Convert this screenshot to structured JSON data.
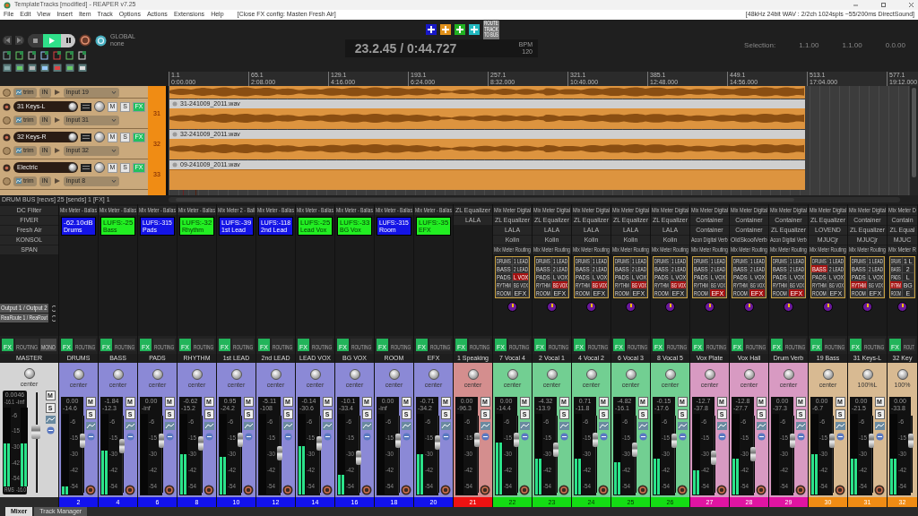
{
  "window": {
    "title": "TemplateTracks [modified] - REAPER v7.25"
  },
  "menu": [
    "File",
    "Edit",
    "View",
    "Insert",
    "Item",
    "Track",
    "Options",
    "Actions",
    "Extensions",
    "Help"
  ],
  "menu_status": "[Close FX config: Masten Fresh Air]",
  "audio_status": "[48kHz 24bit WAV : 2/2ch 1024spls ~55/200ms DirectSound]",
  "transport": {
    "playing": true,
    "automation_label": "GLOBAL",
    "automation_mode": "none"
  },
  "add_buttons": [
    {
      "color": "#1818c8"
    },
    {
      "color": "#e0901a"
    },
    {
      "color": "#22b022"
    },
    {
      "color": "#22b8c0"
    }
  ],
  "route_button": [
    "ROUTE",
    "TRACK",
    "TO BUS"
  ],
  "time": "23.2.45 / 0:44.727",
  "bpm_label": "BPM",
  "bpm": "120",
  "selection": {
    "label": "Selection:",
    "start": "1.1.00",
    "end": "1.1.00",
    "length": "0.0.00"
  },
  "ruler": [
    {
      "bar": "1.1",
      "time": "0:00.000"
    },
    {
      "bar": "65.1",
      "time": "2:08.000"
    },
    {
      "bar": "129.1",
      "time": "4:16.000"
    },
    {
      "bar": "193.1",
      "time": "6:24.000"
    },
    {
      "bar": "257.1",
      "time": "8:32.000"
    },
    {
      "bar": "321.1",
      "time": "10:40.000"
    },
    {
      "bar": "385.1",
      "time": "12:48.000"
    },
    {
      "bar": "449.1",
      "time": "14:56.000"
    },
    {
      "bar": "513.1",
      "time": "17:04.000"
    },
    {
      "bar": "577.1",
      "time": "19:12.000"
    }
  ],
  "partial_track": {
    "automation": "trim",
    "monitor": "IN",
    "input": "Input 19"
  },
  "tracks": [
    {
      "name": "31 Keys-L",
      "number": "31",
      "automation": "trim",
      "monitor": "IN",
      "input": "Input 31",
      "mute": "M",
      "solo": "S",
      "fx": "FX",
      "item": "31-241009_2011.wav",
      "waveform": true
    },
    {
      "name": "32 Keys-R",
      "number": "32",
      "automation": "trim",
      "monitor": "IN",
      "input": "Input 32",
      "mute": "M",
      "solo": "S",
      "fx": "FX",
      "item": "32-241009_2011.wav",
      "waveform": true
    },
    {
      "name": "Electric",
      "number": "33",
      "automation": "trim",
      "monitor": "IN",
      "input": "Input 8",
      "mute": "M",
      "solo": "S",
      "fx": "FX",
      "item": "09-241009_2011.wav",
      "waveform": false
    }
  ],
  "status": "DRUM BUS [recvs] 25 [sends] 1 [FX] 1",
  "master": {
    "name": "MASTER",
    "fx": [
      "DC Filter",
      "FIVER",
      "Fresh Air",
      "KONSOL",
      "SPAN"
    ],
    "sends": [
      "Output 1 / Output 2",
      "ReaRoute 1 / ReaRout"
    ],
    "fx_btn": "FX",
    "routing_btn": "ROUTING",
    "mono_btn": "MONO",
    "pan": "center",
    "volume": "0.0046",
    "peak_l": "-16.1",
    "peak_r": "-inf",
    "scale": [
      "-6",
      "-15",
      "-30",
      "-42",
      "-54"
    ],
    "mute": "M",
    "solo": "S",
    "rms_label": "RMS",
    "rms": "-16.0",
    "meter": {
      "level": 0.55
    },
    "fader": {
      "level": 0.62
    }
  },
  "strips": [
    {
      "name": "DRUMS",
      "number": "2",
      "kind": "bus",
      "fx": [
        "Mix Meter - Ballas"
      ],
      "display": {
        "value": "-62.10dB",
        "label": "Drums",
        "color": "#1414e6"
      },
      "fx_btn": "FX",
      "routing_btn": "ROUTING",
      "pan": "center",
      "volume": "0.00",
      "peak": "-14.6",
      "scale": [
        "-6",
        "-15",
        "-30",
        "-42",
        "-54"
      ],
      "mute": "M",
      "solo": "S",
      "meter": {
        "level": 0.1
      },
      "fader": {
        "level": 0.7
      }
    },
    {
      "name": "BASS",
      "number": "4",
      "kind": "bus",
      "fx": [
        "Mix Meter - Ballas"
      ],
      "display": {
        "value": "LUFS:-25",
        "label": "Bass",
        "color": "#22ee22"
      },
      "fx_btn": "FX",
      "routing_btn": "ROUTING",
      "pan": "center",
      "volume": "-1.84",
      "peak": "-12.3",
      "scale": [
        "-6",
        "-15",
        "-30",
        "-42",
        "-54"
      ],
      "mute": "M",
      "solo": "S",
      "meter": {
        "level": 0.55
      },
      "fader": {
        "level": 0.62
      }
    },
    {
      "name": "PADS",
      "number": "6",
      "kind": "bus",
      "fx": [
        "Mix Meter - Ballas"
      ],
      "display": {
        "value": "LUFS:-315",
        "label": "Pads",
        "color": "#1414e6"
      },
      "fx_btn": "FX",
      "routing_btn": "ROUTING",
      "pan": "center",
      "volume": "0.00",
      "peak": "-inf",
      "scale": [
        "-6",
        "-15",
        "-30",
        "-42",
        "-54"
      ],
      "mute": "M",
      "solo": "S",
      "meter": {
        "level": 0
      },
      "fader": {
        "level": 0.7
      }
    },
    {
      "name": "RHYTHM",
      "number": "8",
      "kind": "bus",
      "fx": [
        "Mix Meter - Ballas"
      ],
      "display": {
        "value": "LUFS:-32",
        "label": "Rhythm",
        "color": "#22ee22"
      },
      "fx_btn": "FX",
      "routing_btn": "ROUTING",
      "pan": "center",
      "volume": "-0.62",
      "peak": "-15.2",
      "scale": [
        "-6",
        "-15",
        "-30",
        "-42",
        "-54"
      ],
      "mute": "M",
      "solo": "S",
      "meter": {
        "level": 0.5
      },
      "fader": {
        "level": 0.66
      }
    },
    {
      "name": "1st LEAD",
      "number": "10",
      "kind": "bus",
      "fx": [
        "Mix Meter 2 - Ball"
      ],
      "display": {
        "value": "LUFS:-39",
        "label": "1st Lead",
        "color": "#1414e6"
      },
      "fx_btn": "FX",
      "routing_btn": "ROUTING",
      "pan": "center",
      "volume": "0.95",
      "peak": "-24.2",
      "scale": [
        "-6",
        "-15",
        "-30",
        "-42",
        "-54"
      ],
      "mute": "M",
      "solo": "S",
      "meter": {
        "level": 0.47
      },
      "fader": {
        "level": 0.72
      }
    },
    {
      "name": "2nd LEAD",
      "number": "12",
      "kind": "bus",
      "fx": [
        "Mix Meter - Ballas"
      ],
      "display": {
        "value": "LUFS:-118",
        "label": "2nd Lead",
        "color": "#1414e6"
      },
      "fx_btn": "FX",
      "routing_btn": "ROUTING",
      "pan": "center",
      "volume": "-5.11",
      "peak": "-108",
      "scale": [
        "-6",
        "-15",
        "-30",
        "-42",
        "-54"
      ],
      "mute": "M",
      "solo": "S",
      "meter": {
        "level": 0
      },
      "fader": {
        "level": 0.52
      }
    },
    {
      "name": "LEAD VOX",
      "number": "14",
      "kind": "bus",
      "fx": [
        "Mix Meter - Ballas"
      ],
      "display": {
        "value": "LUFS:-25",
        "label": "Lead Vox",
        "color": "#22ee22"
      },
      "fx_btn": "FX",
      "routing_btn": "ROUTING",
      "pan": "center",
      "volume": "-0.14",
      "peak": "-30.6",
      "scale": [
        "-6",
        "-15",
        "-30",
        "-42",
        "-54"
      ],
      "mute": "M",
      "solo": "S",
      "meter": {
        "level": 0.6
      },
      "fader": {
        "level": 0.66
      }
    },
    {
      "name": "BG VOX",
      "number": "16",
      "kind": "bus",
      "fx": [
        "Mix Meter - Ballas"
      ],
      "display": {
        "value": "LUFS:-33",
        "label": "BG Vox",
        "color": "#22ee22"
      },
      "fx_btn": "FX",
      "routing_btn": "ROUTING",
      "pan": "center",
      "volume": "-10.1",
      "peak": "-33.4",
      "scale": [
        "-6",
        "-15",
        "-30",
        "-42",
        "-54"
      ],
      "mute": "M",
      "solo": "S",
      "meter": {
        "level": 0.25
      },
      "fader": {
        "level": 0.45
      }
    },
    {
      "name": "ROOM",
      "number": "18",
      "kind": "bus",
      "fx": [
        "Mix Meter - Ballas"
      ],
      "display": {
        "value": "LUFS:-315",
        "label": "Room",
        "color": "#1414e6"
      },
      "fx_btn": "FX",
      "routing_btn": "ROUTING",
      "pan": "center",
      "volume": "0.00",
      "peak": "-inf",
      "scale": [
        "-6",
        "-15",
        "-30",
        "-42",
        "-54"
      ],
      "mute": "M",
      "solo": "S",
      "meter": {
        "level": 0
      },
      "fader": {
        "level": 0.7
      }
    },
    {
      "name": "EFX",
      "number": "20",
      "kind": "bus",
      "fx": [
        "Mix Meter - Ballas"
      ],
      "display": {
        "value": "LUFS:-35",
        "label": "EFX",
        "color": "#22ee22"
      },
      "fx_btn": "FX",
      "routing_btn": "ROUTING",
      "pan": "center",
      "volume": "-0.71",
      "peak": "-34.2",
      "scale": [
        "-6",
        "-15",
        "-30",
        "-42",
        "-54"
      ],
      "mute": "M",
      "solo": "S",
      "meter": {
        "level": 0.5
      },
      "fader": {
        "level": 0.68
      }
    },
    {
      "name": "1 Speaking",
      "number": "21",
      "kind": "speaking",
      "fx": [
        "ZL Equalizer",
        "LALA"
      ],
      "fx_btn": "FX",
      "routing_btn": "ROUTING",
      "pan": "center",
      "volume": "0.00",
      "peak": "-96.3",
      "scale": [
        "-6",
        "-15",
        "-30",
        "-42",
        "-54"
      ],
      "mute": "M",
      "solo": "S",
      "meter": {
        "level": 0
      },
      "fader": {
        "level": 0.72
      }
    },
    {
      "name": "7 Vocal 4",
      "number": "22",
      "kind": "vocal",
      "fx": [
        "Mix Meter Digital",
        "ZL Equalizer",
        "LALA",
        "Kolin",
        "Mix Meter Routing"
      ],
      "routing": [
        {
          "label": "DRUMS",
          "selected": false
        },
        {
          "label": "1 LEAD",
          "selected": false
        },
        {
          "label": "BASS",
          "selected": false
        },
        {
          "label": "2 LEAD",
          "selected": false
        },
        {
          "label": "PADS",
          "selected": false
        },
        {
          "label": "L VOX",
          "selected": true
        },
        {
          "label": "RYTHM",
          "selected": false
        },
        {
          "label": "BG VOX",
          "selected": false
        },
        {
          "label": "ROOM",
          "selected": false
        },
        {
          "label": "EFX",
          "selected": false
        }
      ],
      "fx_btn": "FX",
      "routing_btn": "ROUTING",
      "pan": "center",
      "volume": "0.00",
      "peak": "-14.4",
      "scale": [
        "-6",
        "-15",
        "-30",
        "-42",
        "-54"
      ],
      "mute": "M",
      "solo": "S",
      "meter": {
        "level": 0.65
      },
      "fader": {
        "level": 0.72
      }
    },
    {
      "name": "2 Vocal 1",
      "number": "23",
      "kind": "vocal",
      "fx": [
        "Mix Meter Digital",
        "ZL Equalizer",
        "LALA",
        "Kolin",
        "Mix Meter Routing"
      ],
      "routing": [
        {
          "label": "DRUMS",
          "selected": false
        },
        {
          "label": "1 LEAD",
          "selected": false
        },
        {
          "label": "BASS",
          "selected": false
        },
        {
          "label": "2 LEAD",
          "selected": false
        },
        {
          "label": "PADS",
          "selected": false
        },
        {
          "label": "L VOX",
          "selected": false
        },
        {
          "label": "RYTHM",
          "selected": false
        },
        {
          "label": "BG VOX",
          "selected": true
        },
        {
          "label": "ROOM",
          "selected": false
        },
        {
          "label": "EFX",
          "selected": false
        }
      ],
      "fx_btn": "FX",
      "routing_btn": "ROUTING",
      "pan": "center",
      "volume": "-4.32",
      "peak": "-13.9",
      "scale": [
        "-6",
        "-15",
        "-30",
        "-42",
        "-54"
      ],
      "mute": "M",
      "solo": "S",
      "meter": {
        "level": 0.45
      },
      "fader": {
        "level": 0.57
      }
    },
    {
      "name": "4 Vocal 2",
      "number": "24",
      "kind": "vocal",
      "fx": [
        "Mix Meter Digital",
        "ZL Equalizer",
        "LALA",
        "Kolin",
        "Mix Meter Routing"
      ],
      "routing": [
        {
          "label": "DRUMS",
          "selected": false
        },
        {
          "label": "1 LEAD",
          "selected": false
        },
        {
          "label": "BASS",
          "selected": false
        },
        {
          "label": "2 LEAD",
          "selected": false
        },
        {
          "label": "PADS",
          "selected": false
        },
        {
          "label": "L VOX",
          "selected": false
        },
        {
          "label": "RYTHM",
          "selected": false
        },
        {
          "label": "BG VOX",
          "selected": true
        },
        {
          "label": "ROOM",
          "selected": false
        },
        {
          "label": "EFX",
          "selected": false
        }
      ],
      "fx_btn": "FX",
      "routing_btn": "ROUTING",
      "pan": "center",
      "volume": "0.71",
      "peak": "-11.8",
      "scale": [
        "-6",
        "-15",
        "-30",
        "-42",
        "-54"
      ],
      "mute": "M",
      "solo": "S",
      "meter": {
        "level": 0.45
      },
      "fader": {
        "level": 0.72
      }
    },
    {
      "name": "6 Vocal 3",
      "number": "25",
      "kind": "vocal",
      "fx": [
        "Mix Meter Digital",
        "ZL Equalizer",
        "LALA",
        "Kolin",
        "Mix Meter Routing"
      ],
      "routing": [
        {
          "label": "DRUMS",
          "selected": false
        },
        {
          "label": "1 LEAD",
          "selected": false
        },
        {
          "label": "BASS",
          "selected": false
        },
        {
          "label": "2 LEAD",
          "selected": false
        },
        {
          "label": "PADS",
          "selected": false
        },
        {
          "label": "L VOX",
          "selected": false
        },
        {
          "label": "RYTHM",
          "selected": false
        },
        {
          "label": "BG VOX",
          "selected": true
        },
        {
          "label": "ROOM",
          "selected": false
        },
        {
          "label": "EFX",
          "selected": false
        }
      ],
      "fx_btn": "FX",
      "routing_btn": "ROUTING",
      "pan": "center",
      "volume": "-4.82",
      "peak": "-16.1",
      "scale": [
        "-6",
        "-15",
        "-30",
        "-42",
        "-54"
      ],
      "mute": "M",
      "solo": "S",
      "meter": {
        "level": 0.4
      },
      "fader": {
        "level": 0.57
      }
    },
    {
      "name": "8 Vocal 5",
      "number": "26",
      "kind": "vocal",
      "fx": [
        "Mix Meter Digital",
        "ZL Equalizer",
        "LALA",
        "Kolin",
        "Mix Meter Routing"
      ],
      "routing": [
        {
          "label": "DRUMS",
          "selected": false
        },
        {
          "label": "1 LEAD",
          "selected": false
        },
        {
          "label": "BASS",
          "selected": false
        },
        {
          "label": "2 LEAD",
          "selected": false
        },
        {
          "label": "PADS",
          "selected": false
        },
        {
          "label": "L VOX",
          "selected": false
        },
        {
          "label": "RYTHM",
          "selected": false
        },
        {
          "label": "BG VOX",
          "selected": true
        },
        {
          "label": "ROOM",
          "selected": false
        },
        {
          "label": "EFX",
          "selected": false
        }
      ],
      "fx_btn": "FX",
      "routing_btn": "ROUTING",
      "pan": "center",
      "volume": "-0.15",
      "peak": "-17.6",
      "scale": [
        "-6",
        "-15",
        "-30",
        "-42",
        "-54"
      ],
      "mute": "M",
      "solo": "S",
      "meter": {
        "level": 0.45
      },
      "fader": {
        "level": 0.7
      }
    },
    {
      "name": "Vox Plate",
      "number": "27",
      "kind": "verb",
      "fx": [
        "Mix Meter Digital",
        "Container",
        "Container",
        "Acon Digital Verb",
        "Mix Meter Routing"
      ],
      "routing": [
        {
          "label": "DRUMS",
          "selected": false
        },
        {
          "label": "1 LEAD",
          "selected": false
        },
        {
          "label": "BASS",
          "selected": false
        },
        {
          "label": "2 LEAD",
          "selected": false
        },
        {
          "label": "PADS",
          "selected": false
        },
        {
          "label": "L VOX",
          "selected": false
        },
        {
          "label": "RYTHM",
          "selected": false
        },
        {
          "label": "BG VOX",
          "selected": false
        },
        {
          "label": "ROOM",
          "selected": false
        },
        {
          "label": "EFX",
          "selected": true
        }
      ],
      "fx_btn": "FX",
      "routing_btn": "ROUTING",
      "pan": "center",
      "volume": "-12.7",
      "peak": "-37.8",
      "scale": [
        "-6",
        "-15",
        "-30",
        "-42",
        "-54"
      ],
      "mute": "M",
      "solo": "S",
      "meter": {
        "level": 0.3
      },
      "fader": {
        "level": 0.45
      }
    },
    {
      "name": "Vox Hall",
      "number": "28",
      "kind": "verb",
      "fx": [
        "Mix Meter Digital",
        "Container",
        "Container",
        "OldSkoolVerb",
        "Mix Meter Routing"
      ],
      "routing": [
        {
          "label": "DRUMS",
          "selected": false
        },
        {
          "label": "1 LEAD",
          "selected": false
        },
        {
          "label": "BASS",
          "selected": false
        },
        {
          "label": "2 LEAD",
          "selected": false
        },
        {
          "label": "PADS",
          "selected": false
        },
        {
          "label": "L VOX",
          "selected": false
        },
        {
          "label": "RYTHM",
          "selected": false
        },
        {
          "label": "BG VOX",
          "selected": false
        },
        {
          "label": "ROOM",
          "selected": false
        },
        {
          "label": "EFX",
          "selected": true
        }
      ],
      "fx_btn": "FX",
      "routing_btn": "ROUTING",
      "pan": "center",
      "volume": "-12.8",
      "peak": "-27.7",
      "scale": [
        "-6",
        "-15",
        "-30",
        "-42",
        "-54"
      ],
      "mute": "M",
      "solo": "S",
      "meter": {
        "level": 0.45
      },
      "fader": {
        "level": 0.5
      }
    },
    {
      "name": "Drum Verb",
      "number": "29",
      "kind": "verb",
      "fx": [
        "Mix Meter Digital",
        "Container",
        "ZL Equalizer",
        "Acon Digital Verb",
        "Mix Meter Routing"
      ],
      "routing": [
        {
          "label": "DRUMS",
          "selected": false
        },
        {
          "label": "1 LEAD",
          "selected": false
        },
        {
          "label": "BASS",
          "selected": false
        },
        {
          "label": "2 LEAD",
          "selected": false
        },
        {
          "label": "PADS",
          "selected": false
        },
        {
          "label": "L VOX",
          "selected": false
        },
        {
          "label": "RYTHM",
          "selected": false
        },
        {
          "label": "BG VOX",
          "selected": false
        },
        {
          "label": "ROOM",
          "selected": false
        },
        {
          "label": "EFX",
          "selected": true
        }
      ],
      "fx_btn": "FX",
      "routing_btn": "ROUTING",
      "pan": "center",
      "volume": "0.00",
      "peak": "-37.3",
      "scale": [
        "-6",
        "-15",
        "-30",
        "-42",
        "-54"
      ],
      "mute": "M",
      "solo": "S",
      "meter": {
        "level": 0
      },
      "fader": {
        "level": 0.7
      }
    },
    {
      "name": "19 Bass",
      "number": "30",
      "kind": "keys",
      "fx": [
        "Mix Meter Digital",
        "ZL Equalizer",
        "LOVEND",
        "MJUCjr",
        "Mix Meter Routing"
      ],
      "routing": [
        {
          "label": "DRUMS",
          "selected": false
        },
        {
          "label": "1 LEAD",
          "selected": false
        },
        {
          "label": "BASS",
          "selected": true
        },
        {
          "label": "2 LEAD",
          "selected": false
        },
        {
          "label": "PADS",
          "selected": false
        },
        {
          "label": "L VOX",
          "selected": false
        },
        {
          "label": "RYTHM",
          "selected": false
        },
        {
          "label": "BG VOX",
          "selected": false
        },
        {
          "label": "ROOM",
          "selected": false
        },
        {
          "label": "EFX",
          "selected": false
        }
      ],
      "fx_btn": "FX",
      "routing_btn": "ROUTING",
      "pan": "center",
      "volume": "0.00",
      "peak": "-6.7",
      "scale": [
        "-6",
        "-15",
        "-30",
        "-42",
        "-54"
      ],
      "mute": "M",
      "solo": "S",
      "meter": {
        "level": 0.5
      },
      "fader": {
        "level": 0.7
      }
    },
    {
      "name": "31 Keys-L",
      "number": "31",
      "kind": "keys",
      "fx": [
        "Mix Meter Digital",
        "Container",
        "ZL Equalizer",
        "MJUCjr",
        "Mix Meter Routing"
      ],
      "routing": [
        {
          "label": "DRUMS",
          "selected": false
        },
        {
          "label": "1 LEAD",
          "selected": false
        },
        {
          "label": "BASS",
          "selected": false
        },
        {
          "label": "2 LEAD",
          "selected": false
        },
        {
          "label": "PADS",
          "selected": false
        },
        {
          "label": "L VOX",
          "selected": false
        },
        {
          "label": "RYTHM",
          "selected": true
        },
        {
          "label": "BG VOX",
          "selected": false
        },
        {
          "label": "ROOM",
          "selected": false
        },
        {
          "label": "EFX",
          "selected": false
        }
      ],
      "fx_btn": "FX",
      "routing_btn": "ROUTING",
      "pan": "100%L",
      "volume": "0.00",
      "peak": "-21.5",
      "scale": [
        "-6",
        "-15",
        "-30",
        "-42",
        "-54"
      ],
      "mute": "M",
      "solo": "S",
      "meter": {
        "level": 0.45
      },
      "fader": {
        "level": 0.7
      }
    },
    {
      "name": "32 Key",
      "number": "32",
      "kind": "keys",
      "fx": [
        "Mix Meter D",
        "Contain",
        "ZL Equal",
        "MJUC",
        "Mix Meter R"
      ],
      "routing": [
        {
          "label": "DRUMS",
          "selected": false
        },
        {
          "label": "1 L",
          "selected": false
        },
        {
          "label": "BASS",
          "selected": false
        },
        {
          "label": "2",
          "selected": false
        },
        {
          "label": "PADS",
          "selected": false
        },
        {
          "label": "L",
          "selected": false
        },
        {
          "label": "RYTHM",
          "selected": true
        },
        {
          "label": "BG",
          "selected": false
        },
        {
          "label": "ROOM",
          "selected": false
        },
        {
          "label": "E",
          "selected": false
        }
      ],
      "fx_btn": "FX",
      "routing_btn": "ROUT",
      "pan": "100%",
      "volume": "0.00",
      "peak": "-33.8",
      "scale": [
        "-6",
        "-15",
        "-30",
        "-42",
        "-54"
      ],
      "meter": {
        "level": 0.45
      },
      "fader": {
        "level": 0.7
      }
    }
  ],
  "bottom_tabs": [
    {
      "label": "Mixer",
      "selected": true
    },
    {
      "label": "Track Manager",
      "selected": false
    }
  ]
}
